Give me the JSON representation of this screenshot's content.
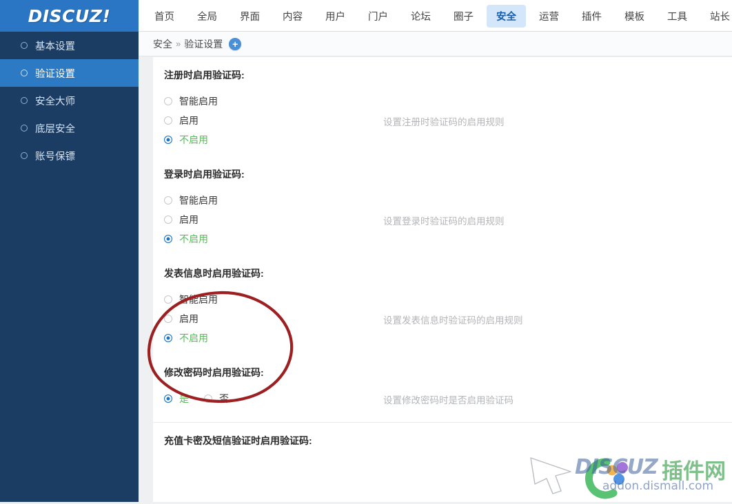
{
  "brand": {
    "logo_text": "DISCUZ!"
  },
  "topnav": {
    "items": [
      {
        "label": "首页",
        "active": false
      },
      {
        "label": "全局",
        "active": false
      },
      {
        "label": "界面",
        "active": false
      },
      {
        "label": "内容",
        "active": false
      },
      {
        "label": "用户",
        "active": false
      },
      {
        "label": "门户",
        "active": false
      },
      {
        "label": "论坛",
        "active": false
      },
      {
        "label": "圈子",
        "active": false
      },
      {
        "label": "安全",
        "active": true
      },
      {
        "label": "运营",
        "active": false
      },
      {
        "label": "插件",
        "active": false
      },
      {
        "label": "模板",
        "active": false
      },
      {
        "label": "工具",
        "active": false
      },
      {
        "label": "站长",
        "active": false
      }
    ]
  },
  "sidebar": {
    "items": [
      {
        "label": "基本设置",
        "active": false
      },
      {
        "label": "验证设置",
        "active": true
      },
      {
        "label": "安全大师",
        "active": false
      },
      {
        "label": "底层安全",
        "active": false
      },
      {
        "label": "账号保镖",
        "active": false
      }
    ]
  },
  "breadcrumb": {
    "root": "安全",
    "separator": "»",
    "current": "验证设置",
    "add_label": "+"
  },
  "main": {
    "fields": [
      {
        "title": "注册时启用验证码:",
        "hint": "设置注册时验证码的启用规则",
        "layout": "stacked",
        "options": [
          {
            "label": "智能启用",
            "selected": false
          },
          {
            "label": "启用",
            "selected": false
          },
          {
            "label": "不启用",
            "selected": true
          }
        ]
      },
      {
        "title": "登录时启用验证码:",
        "hint": "设置登录时验证码的启用规则",
        "layout": "stacked",
        "options": [
          {
            "label": "智能启用",
            "selected": false
          },
          {
            "label": "启用",
            "selected": false
          },
          {
            "label": "不启用",
            "selected": true
          }
        ]
      },
      {
        "title": "发表信息时启用验证码:",
        "hint": "设置发表信息时验证码的启用规则",
        "layout": "stacked",
        "annotated": true,
        "options": [
          {
            "label": "智能启用",
            "selected": false
          },
          {
            "label": "启用",
            "selected": false
          },
          {
            "label": "不启用",
            "selected": true
          }
        ]
      },
      {
        "title": "修改密码时启用验证码:",
        "hint": "设置修改密码时是否启用验证码",
        "layout": "inline",
        "options": [
          {
            "label": "是",
            "selected": true
          },
          {
            "label": "否",
            "selected": false
          }
        ]
      },
      {
        "title": "充值卡密及短信验证时启用验证码:",
        "hint": "",
        "layout": "stacked",
        "options": []
      }
    ]
  },
  "annotation": {
    "shape": "ellipse",
    "color": "#9c1f22"
  },
  "watermark": {
    "brand_latin": "DISCUZ",
    "brand_cn": "插件网",
    "url": "addon.dismall.com"
  },
  "colors": {
    "accent_blue": "#2b76c4",
    "sidebar_bg": "#1c3d63",
    "sidebar_active": "#2d7ac4",
    "tab_active_bg": "#d4e6fa",
    "selected_label_green": "#5cb85c",
    "radio_on": "#1a73c7",
    "hint_gray": "#b3b5b8",
    "annotation_red": "#9c1f22"
  }
}
